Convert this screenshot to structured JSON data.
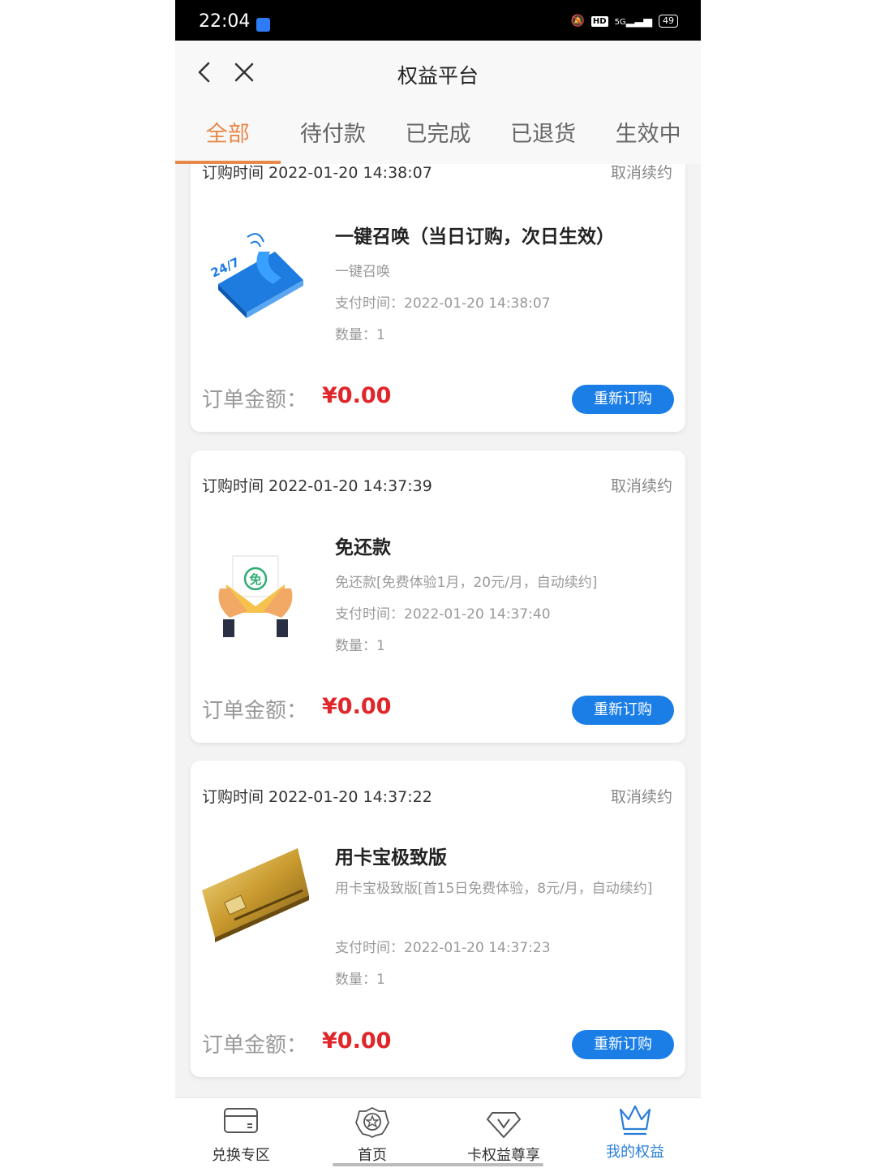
{
  "status_bar": {
    "time": "22:04",
    "network": "5G",
    "hd": "HD",
    "battery": "49"
  },
  "header": {
    "title": "权益平台"
  },
  "tabs": [
    {
      "label": "全部",
      "active": true
    },
    {
      "label": "待付款",
      "active": false
    },
    {
      "label": "已完成",
      "active": false
    },
    {
      "label": "已退货",
      "active": false
    },
    {
      "label": "生效中",
      "active": false
    }
  ],
  "orders": [
    {
      "order_time": "订购时间 2022-01-20 14:38:07",
      "cancel_label": "取消续约",
      "title": "一键召唤（当日订购，次日生效）",
      "description": "一键召唤",
      "pay_time": "支付时间：2022-01-20 14:38:07",
      "quantity": "数量：1",
      "amount_label": "订单金额：",
      "amount": "¥0.00",
      "button_label": "重新订购",
      "thumb_icon": "phone-24-7-icon"
    },
    {
      "order_time": "订购时间 2022-01-20 14:37:39",
      "cancel_label": "取消续约",
      "title": "免还款",
      "description": "免还款[免费体验1月，20元/月，自动续约]",
      "pay_time": "支付时间：2022-01-20 14:37:40",
      "quantity": "数量：1",
      "amount_label": "订单金额：",
      "amount": "¥0.00",
      "button_label": "重新订购",
      "thumb_icon": "envelope-hands-icon",
      "thumb_text": "免"
    },
    {
      "order_time": "订购时间 2022-01-20 14:37:22",
      "cancel_label": "取消续约",
      "title": "用卡宝极致版",
      "description": "用卡宝极致版[首15日免费体验，8元/月，自动续约]",
      "pay_time": "支付时间：2022-01-20 14:37:23",
      "quantity": "数量：1",
      "amount_label": "订单金额：",
      "amount": "¥0.00",
      "button_label": "重新订购",
      "thumb_icon": "gold-card-icon"
    }
  ],
  "bottom_nav": [
    {
      "label": "兑换专区",
      "icon": "card-icon",
      "active": false
    },
    {
      "label": "首页",
      "icon": "badge-star-icon",
      "active": false
    },
    {
      "label": "卡权益尊享",
      "icon": "diamond-v-icon",
      "active": false
    },
    {
      "label": "我的权益",
      "icon": "crown-icon",
      "active": true
    }
  ],
  "colors": {
    "accent": "#e8894a",
    "price": "#e0262a",
    "button": "#1a7ee6",
    "nav_active": "#2a7ed8"
  }
}
